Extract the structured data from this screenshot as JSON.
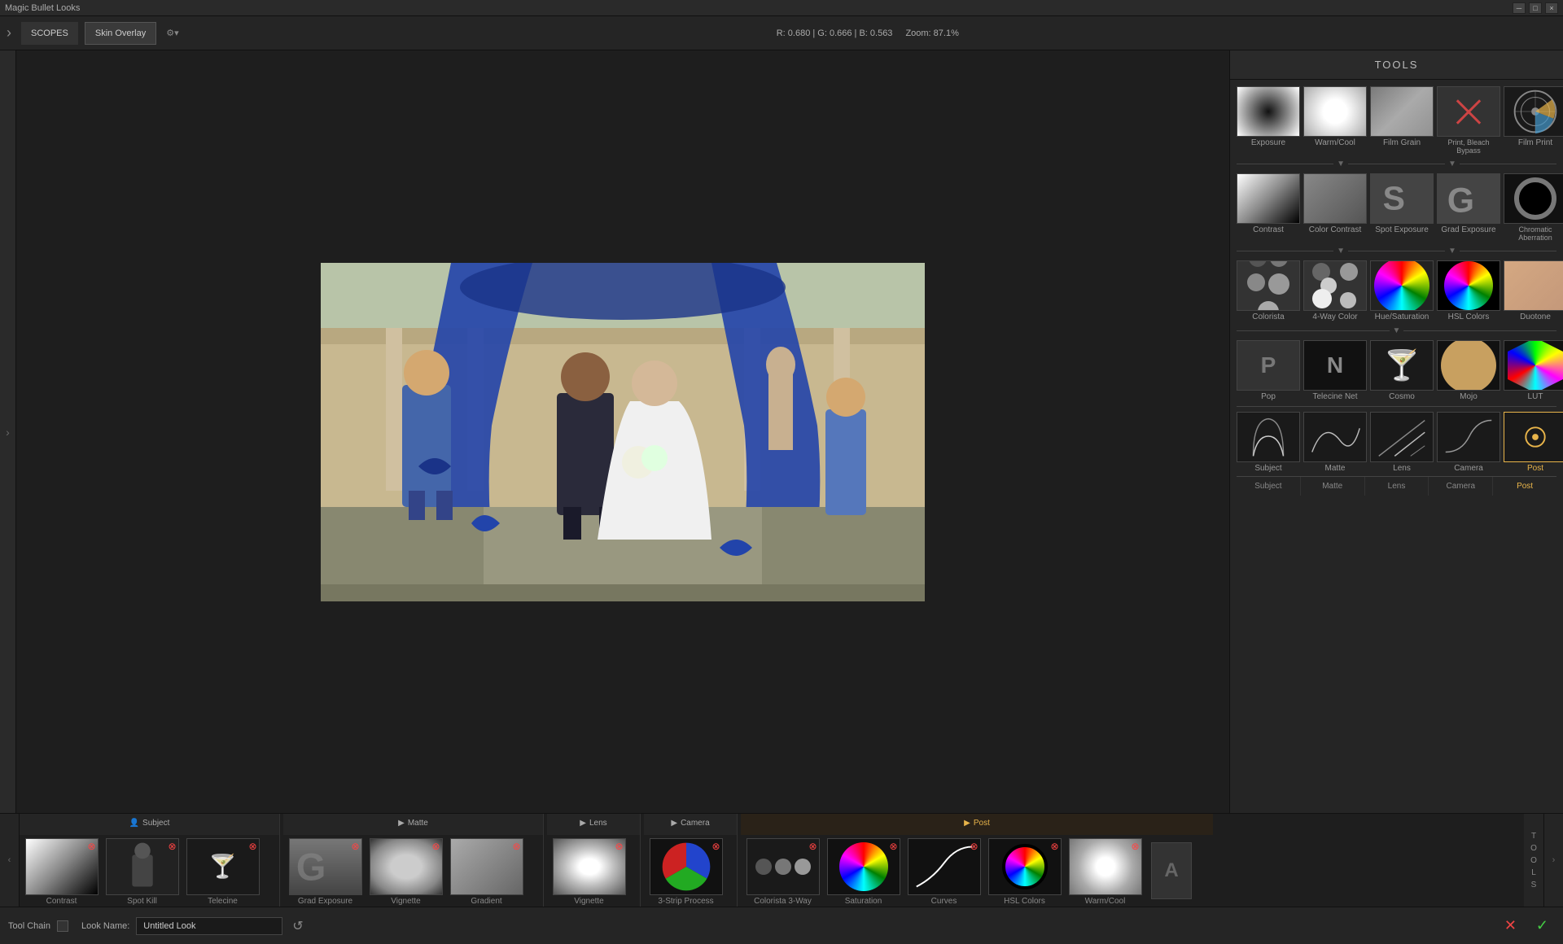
{
  "titlebar": {
    "title": "Magic Bullet Looks",
    "min_btn": "─",
    "max_btn": "□",
    "close_btn": "×"
  },
  "topbar": {
    "scopes_label": "SCOPES",
    "skin_overlay_label": "Skin Overlay",
    "color_info": "R: 0.680  |  G: 0.666  |  B: 0.563",
    "zoom_label": "Zoom: 87.1%",
    "chevron": "›",
    "settings_icon": "⚙"
  },
  "tools": {
    "header": "TOOLS",
    "rows": [
      {
        "items": [
          {
            "id": "exposure",
            "label": "Exposure",
            "thumb_type": "exposure"
          },
          {
            "id": "warm-cool",
            "label": "Warm/Cool",
            "thumb_type": "warmcool"
          },
          {
            "id": "film-grain",
            "label": "Film Grain",
            "thumb_type": "filmgrain"
          },
          {
            "id": "print-bleach",
            "label": "Print, Bleach Bypass",
            "thumb_type": "printbleach"
          },
          {
            "id": "film-print",
            "label": "Film Print",
            "thumb_type": "filmprint"
          }
        ]
      },
      {
        "divider": true
      },
      {
        "items": [
          {
            "id": "contrast",
            "label": "Contrast",
            "thumb_type": "contrast"
          },
          {
            "id": "color-contrast",
            "label": "Color Contrast",
            "thumb_type": "colorcontrast"
          },
          {
            "id": "spot-exposure",
            "label": "Spot Exposure",
            "thumb_type": "spotexposure"
          },
          {
            "id": "grad-exposure",
            "label": "Grad Exposure",
            "thumb_type": "gradexposure"
          },
          {
            "id": "chromatic-aberration",
            "label": "Chromatic Aberration",
            "thumb_type": "chromaticab"
          }
        ]
      },
      {
        "divider": true
      },
      {
        "items": [
          {
            "id": "colorista",
            "label": "Colorista",
            "thumb_type": "colorista"
          },
          {
            "id": "4way-color",
            "label": "4-Way Color",
            "thumb_type": "4waycolor"
          },
          {
            "id": "hue-saturation",
            "label": "Hue/Saturation",
            "thumb_type": "huesat"
          },
          {
            "id": "hsl-colors",
            "label": "HSL Colors",
            "thumb_type": "hslcolors"
          },
          {
            "id": "duotone",
            "label": "Duotone",
            "thumb_type": "duotone"
          }
        ]
      },
      {
        "divider": true
      },
      {
        "items": [
          {
            "id": "pop",
            "label": "Pop",
            "thumb_type": "pop"
          },
          {
            "id": "telecine-net",
            "label": "Telecine Net",
            "thumb_type": "telecinenet"
          },
          {
            "id": "cosmo",
            "label": "Cosmo",
            "thumb_type": "cosmo"
          },
          {
            "id": "mojo",
            "label": "Mojo",
            "thumb_type": "mojo"
          },
          {
            "id": "lut",
            "label": "LUT",
            "thumb_type": "lut"
          }
        ]
      },
      {
        "divider": true
      },
      {
        "items": [
          {
            "id": "subject-tool",
            "label": "Subject",
            "thumb_type": "subject"
          },
          {
            "id": "matte-tool",
            "label": "Matte",
            "thumb_type": "matte"
          },
          {
            "id": "lens-tool",
            "label": "Lens",
            "thumb_type": "lens"
          },
          {
            "id": "camera-tool",
            "label": "Camera",
            "thumb_type": "camera"
          },
          {
            "id": "post-tool",
            "label": "Post",
            "thumb_type": "post"
          }
        ]
      }
    ],
    "categories": [
      {
        "id": "subject",
        "label": "Subject",
        "active": false
      },
      {
        "id": "matte",
        "label": "Matte",
        "active": false
      },
      {
        "id": "lens",
        "label": "Lens",
        "active": false
      },
      {
        "id": "camera",
        "label": "Camera",
        "active": false
      },
      {
        "id": "post",
        "label": "Post",
        "active": true
      }
    ]
  },
  "looks_bar": {
    "sections": [
      {
        "id": "subject-section",
        "label": "Subject",
        "icon": "👤",
        "items": [
          {
            "id": "contrast-look",
            "label": "Contrast",
            "thumb": "contrast"
          },
          {
            "id": "spot-look",
            "label": "Spot Kill",
            "thumb": "spot"
          },
          {
            "id": "telecine-look",
            "label": "Telecine",
            "thumb": "telecine"
          }
        ]
      },
      {
        "id": "matte-section",
        "label": "Matte",
        "icon": "▶",
        "items": [
          {
            "id": "grad-look",
            "label": "Grad Exposure",
            "thumb": "grad"
          },
          {
            "id": "vignette-look2",
            "label": "Vignette",
            "thumb": "vignette2"
          },
          {
            "id": "gradient-look",
            "label": "Gradient",
            "thumb": "gradient"
          }
        ]
      },
      {
        "id": "lens-section",
        "label": "Lens",
        "icon": "▶",
        "items": [
          {
            "id": "vignette-look",
            "label": "Vignette",
            "thumb": "vignette"
          }
        ]
      },
      {
        "id": "camera-section",
        "label": "Camera",
        "icon": "▶",
        "items": [
          {
            "id": "3strip-look",
            "label": "3-Strip Process",
            "thumb": "3strip"
          }
        ]
      },
      {
        "id": "post-section",
        "label": "Post",
        "icon": "▶",
        "items": [
          {
            "id": "colorista3way-look",
            "label": "Colorista 3-Way",
            "thumb": "colorista3way"
          },
          {
            "id": "saturation-look",
            "label": "Saturation",
            "thumb": "saturation"
          },
          {
            "id": "curves-look",
            "label": "Curves",
            "thumb": "curves"
          },
          {
            "id": "hslcolors-look",
            "label": "HSL Colors",
            "thumb": "hslcolors"
          },
          {
            "id": "warmcool-look",
            "label": "Warm/Cool",
            "thumb": "warmcool"
          }
        ]
      }
    ]
  },
  "footer": {
    "tool_chain_label": "Tool Chain",
    "look_name_label": "Look Name:",
    "look_name_value": "Untitled Look",
    "reset_icon": "↺",
    "cancel_icon": "✕",
    "ok_icon": "✓"
  }
}
